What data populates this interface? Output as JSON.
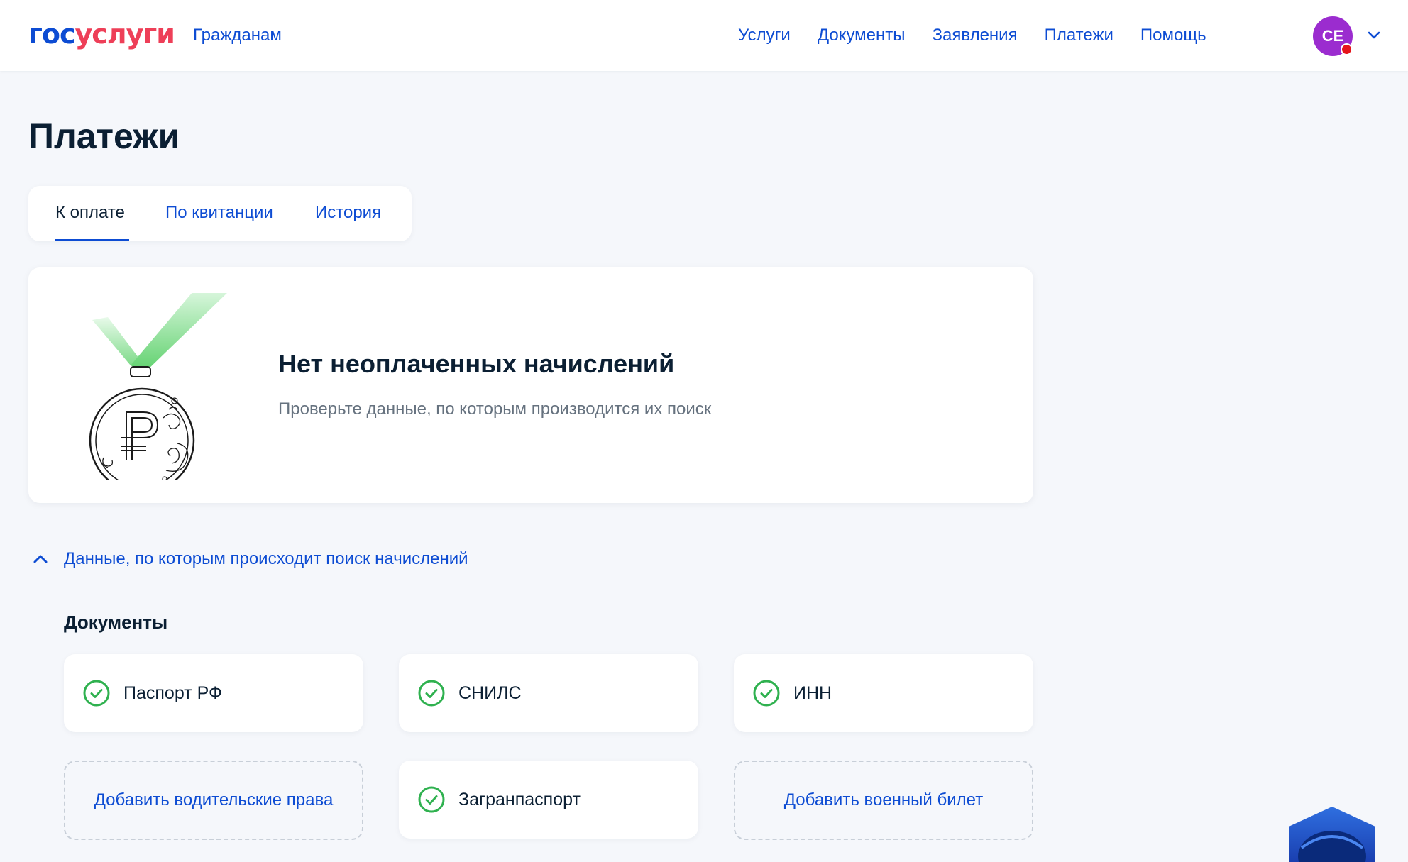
{
  "header": {
    "logo": {
      "part1": "гос",
      "part2": "услуги"
    },
    "section_link": "Гражданам",
    "nav": [
      "Услуги",
      "Документы",
      "Заявления",
      "Платежи",
      "Помощь"
    ],
    "avatar_initials": "СЕ",
    "colors": {
      "brand_blue": "#0d4cd3",
      "brand_red": "#ee3f58",
      "avatar_bg": "#9b2ccf",
      "notification": "#e5141b"
    }
  },
  "page": {
    "title": "Платежи"
  },
  "tabs": [
    {
      "label": "К оплате",
      "active": true
    },
    {
      "label": "По квитанции",
      "active": false
    },
    {
      "label": "История",
      "active": false
    }
  ],
  "empty_state": {
    "icon": "ruble-medal-icon",
    "title": "Нет неоплаченных начислений",
    "subtitle": "Проверьте данные, по которым производится их поиск"
  },
  "search_data": {
    "toggle_label": "Данные, по которым происходит поиск начислений",
    "documents_title": "Документы",
    "documents": [
      {
        "label": "Паспорт РФ",
        "status": "added"
      },
      {
        "label": "СНИЛС",
        "status": "added"
      },
      {
        "label": "ИНН",
        "status": "added"
      },
      {
        "label": "Добавить водительские права",
        "status": "missing"
      },
      {
        "label": "Загранпаспорт",
        "status": "added"
      },
      {
        "label": "Добавить военный билет",
        "status": "missing"
      }
    ]
  }
}
